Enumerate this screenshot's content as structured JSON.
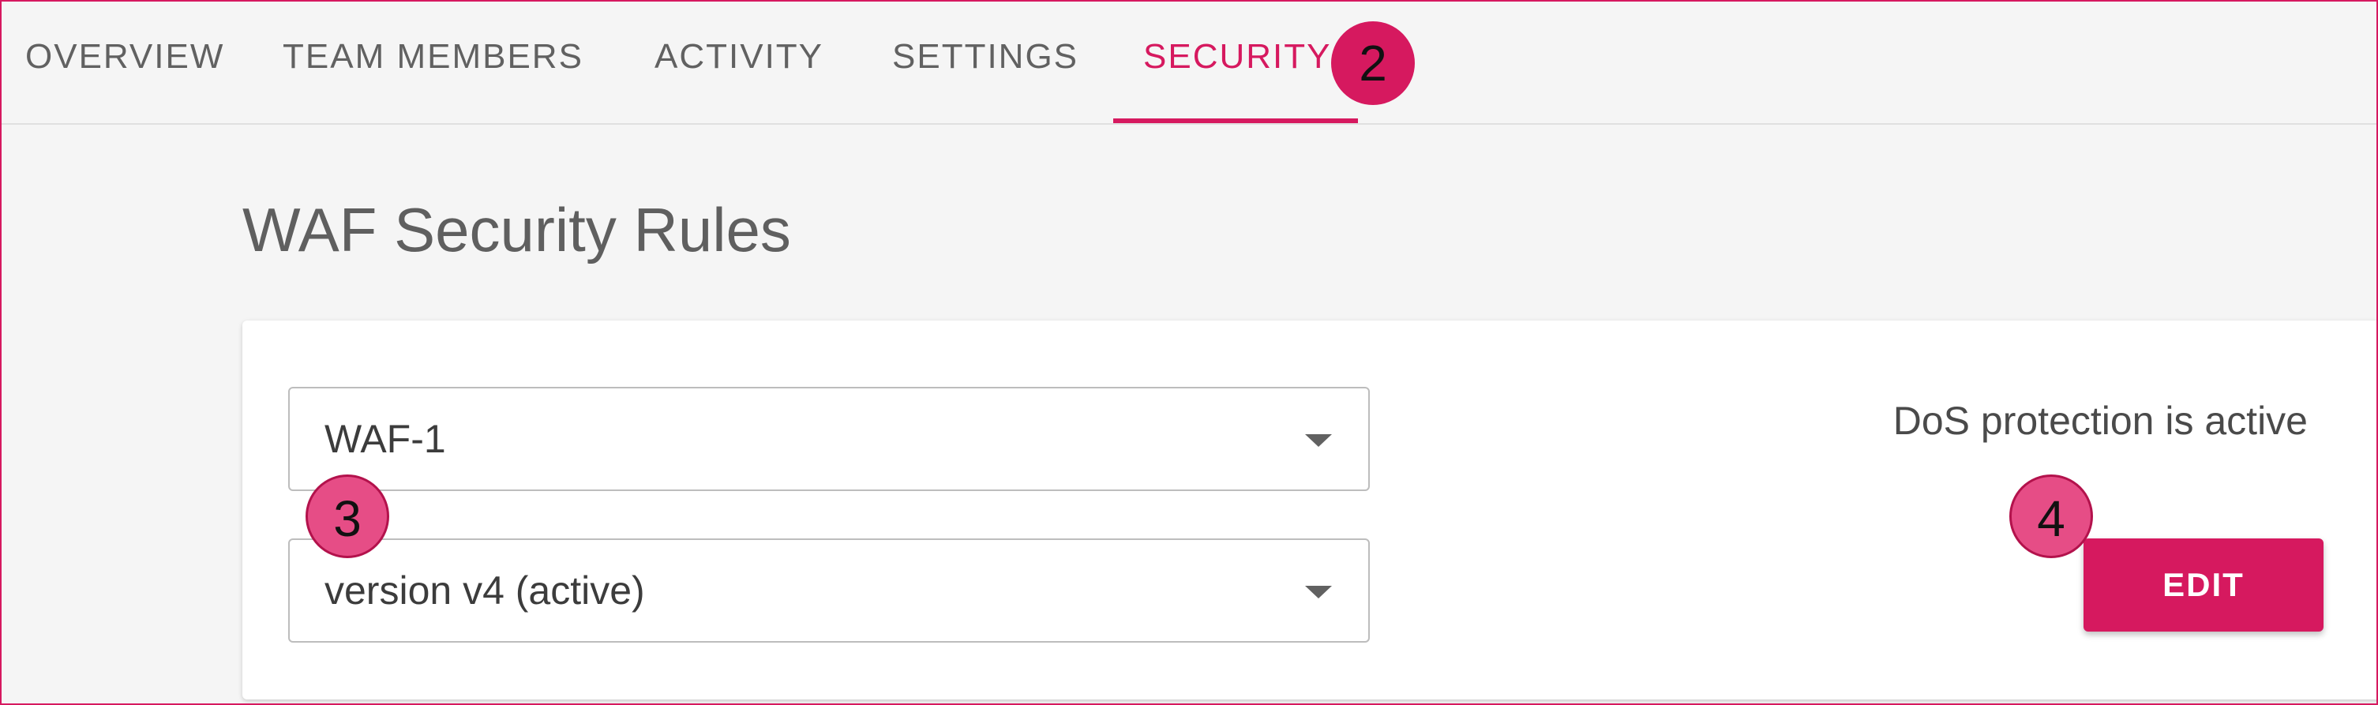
{
  "tabs": [
    {
      "label": "OVERVIEW"
    },
    {
      "label": "TEAM MEMBERS"
    },
    {
      "label": "ACTIVITY"
    },
    {
      "label": "SETTINGS"
    },
    {
      "label": "SECURITY",
      "active": true
    }
  ],
  "callouts": [
    "2",
    "3",
    "4"
  ],
  "page": {
    "title": "WAF Security Rules"
  },
  "waf": {
    "rule_select_value": "WAF-1",
    "version_select_value": "version v4 (active)",
    "dos_status": "DoS protection is active",
    "edit_label": "EDIT"
  },
  "colors": {
    "accent": "#d6195f",
    "background": "#f5f5f5",
    "card": "#ffffff",
    "text_muted": "#616161"
  }
}
